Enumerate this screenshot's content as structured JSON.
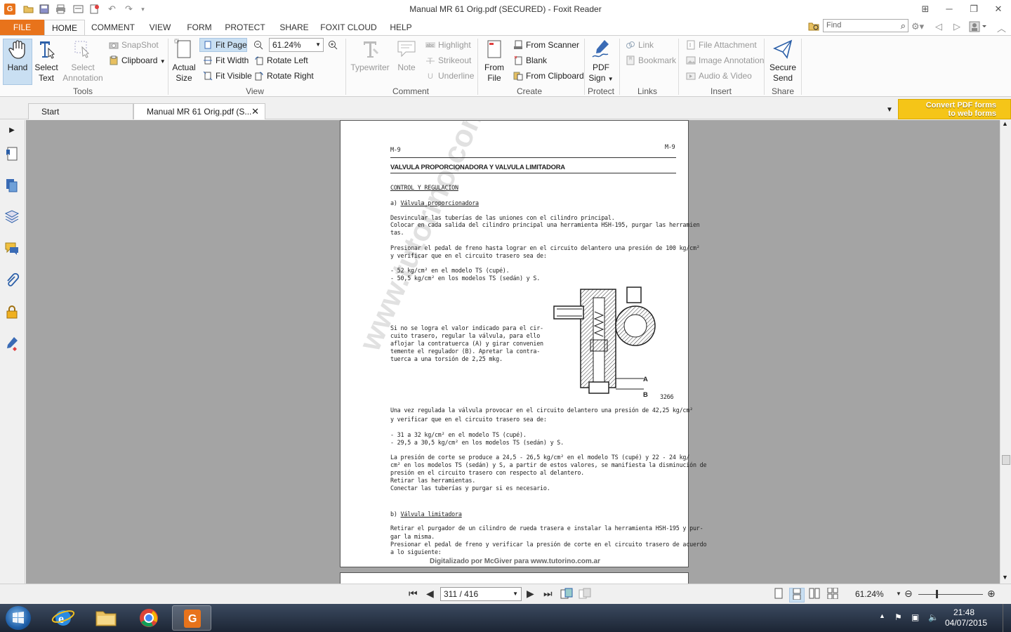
{
  "window": {
    "title": "Manual MR 61 Orig.pdf (SECURED) - Foxit Reader",
    "minimize": "─",
    "restore": "❐",
    "close": "✕"
  },
  "menu": {
    "tabs": [
      "FILE",
      "HOME",
      "COMMENT",
      "VIEW",
      "FORM",
      "PROTECT",
      "SHARE",
      "FOXIT CLOUD",
      "HELP"
    ],
    "find_placeholder": "Find"
  },
  "ribbon": {
    "tools": {
      "hand": "Hand",
      "select_text_1": "Select",
      "select_text_2": "Text",
      "select_annotation_1": "Select",
      "select_annotation_2": "Annotation",
      "snapshot": "SnapShot",
      "clipboard": "Clipboard",
      "group": "Tools"
    },
    "view": {
      "actual_size_1": "Actual",
      "actual_size_2": "Size",
      "fit_page": "Fit Page",
      "fit_width": "Fit Width",
      "fit_visible": "Fit Visible",
      "zoom_value": "61.24%",
      "rotate_left": "Rotate Left",
      "rotate_right": "Rotate Right",
      "group": "View"
    },
    "comment": {
      "typewriter": "Typewriter",
      "note": "Note",
      "highlight": "Highlight",
      "strikeout": "Strikeout",
      "underline": "Underline",
      "group": "Comment"
    },
    "create": {
      "from_file_1": "From",
      "from_file_2": "File",
      "from_scanner": "From Scanner",
      "blank": "Blank",
      "from_clipboard": "From Clipboard",
      "group": "Create"
    },
    "protect": {
      "pdf_sign_1": "PDF",
      "pdf_sign_2": "Sign",
      "group": "Protect"
    },
    "links": {
      "link": "Link",
      "bookmark": "Bookmark",
      "group": "Links"
    },
    "insert": {
      "file_attachment": "File Attachment",
      "image_annotation": "Image Annotation",
      "audio_video": "Audio & Video",
      "group": "Insert"
    },
    "share": {
      "secure_send_1": "Secure",
      "secure_send_2": "Send",
      "group": "Share"
    }
  },
  "doc_tabs": {
    "start": "Start",
    "active": "Manual MR 61 Orig.pdf (S...",
    "convert_banner_1": "Convert PDF forms",
    "convert_banner_2": "to web forms"
  },
  "page": {
    "header_left": "M-9",
    "header_right": "M-9",
    "title": "VALVULA PROPORCIONADORA Y VALVULA LIMITADORA",
    "section": "CONTROL Y REGULACION",
    "sub_a_prefix": "a)",
    "sub_a": "Válvula proporcionadora",
    "p1": "Desvincular las tuberías de las uniones con el cilindro principal.",
    "p2": "Colocar en cada salida del cilindro principal una herramienta HSH-195, purgar las herramien",
    "p3": "tas.",
    "p4": "Presionar el pedal de freno hasta lograr en el circuito delantero una presión de 100 kg/cm²",
    "p5": "y verificar que en el circuito trasero sea de:",
    "p6": "- 52 kg/cm² en el modelo TS (cupé).",
    "p7": "- 50,5 kg/cm² en los modelos TS (sedán) y S.",
    "side1": "Si no se logra el valor indicado para el cir-",
    "side2": "cuito trasero, regular la válvula, para ello",
    "side3": "aflojar la contratuerca (A) y girar convenien",
    "side4": "temente el regulador (B). Apretar la contra-",
    "side5": "tuerca a una torsión de 2,25 mkg.",
    "fig_a": "A",
    "fig_b": "B",
    "fig_num": "3266",
    "p8": "Una vez regulada la válvula provocar en el circuito delantero una presión de 42,25 kg/cm²",
    "p9": "y verificar que en el circuito trasero sea de:",
    "p10": "- 31 a 32 kg/cm² en el modelo TS (cupé).",
    "p11": "- 29,5 a 30,5 kg/cm² en los modelos TS (sedán) y S.",
    "p12": "La presión de corte se produce a 24,5 - 26,5 kg/cm² en el modelo TS (cupé) y 22 - 24 kg/",
    "p13": "cm² en los modelos TS (sedán) y S, a partir de estos valores, se manifiesta la disminución de",
    "p14": "presión en el circuito trasero con respecto al delantero.",
    "p15": "Retirar las herramientas.",
    "p16": "Conectar las tuberías y purgar si es necesario.",
    "sub_b_prefix": "b)",
    "sub_b": "Válvula limitadora",
    "p17": "Retirar el purgador de un cilindro de rueda trasera e instalar la herramienta HSH-195 y pur-",
    "p18": "gar la misma.",
    "p19": "Presionar el pedal de freno y verificar la presión de corte en el circuito trasero de acuerdo",
    "p20": "a lo siguiente:",
    "watermark": "www.tutorino.com.ar",
    "footer": "Digitalizado por McGiver para www.tutorino.com.ar"
  },
  "statusbar": {
    "page_value": "311 / 416",
    "zoom": "61.24%"
  },
  "taskbar": {
    "time": "21:48",
    "date": "04/07/2015"
  },
  "colors": {
    "accent": "#e8731b",
    "ribbon_active": "#c9dff2",
    "doc_background": "#a4a4a4",
    "banner": "#f5c518"
  }
}
